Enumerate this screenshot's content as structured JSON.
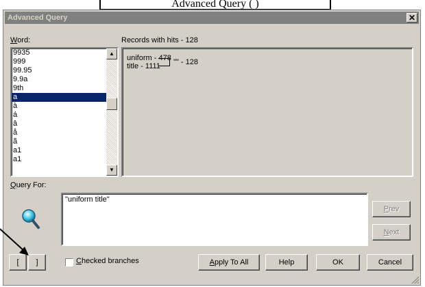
{
  "caption": "Advanced Query (   )",
  "window": {
    "title": "Advanced Query",
    "close_label": "✕"
  },
  "word_label": "Word:",
  "word_list": {
    "items": [
      "9935",
      "999",
      "99.95",
      "9.9a",
      "9th",
      "a",
      "à",
      "á",
      "â",
      "å",
      "ã",
      "a1",
      "a1"
    ],
    "selected": "a"
  },
  "results": {
    "header": "Records with hits - 128",
    "line1": "uniform - 478",
    "line2": "title - 1111",
    "combined": "\"\" - 128"
  },
  "query_label": "Query For:",
  "query_value": "\"uniform title\"",
  "buttons": {
    "open_bracket": "[",
    "close_bracket": "]",
    "prev": "Prev",
    "next": "Next",
    "apply_all": "Apply To All",
    "help": "Help",
    "ok": "OK",
    "cancel": "Cancel"
  },
  "checked_branches_label": "Checked branches",
  "icons": {
    "magnifier": "magnifier-icon",
    "close": "close-icon"
  }
}
